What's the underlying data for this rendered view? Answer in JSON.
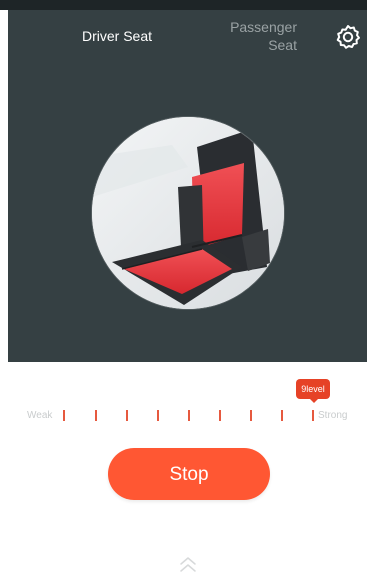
{
  "tabs": {
    "driver_label": "Driver Seat",
    "passenger_label": "Passenger\nSeat",
    "active": "driver"
  },
  "icons": {
    "settings": "gear-icon",
    "link": "link-icon",
    "expand": "chevron-up-icon"
  },
  "seat_image": "seat-photo",
  "intensity": {
    "weak_label": "Weak",
    "strong_label": "Strong",
    "level_label": "9level",
    "level": 9,
    "max_level": 9
  },
  "stop_label": "Stop",
  "colors": {
    "header_bg": "#354043",
    "accent": "#ff5733",
    "tick": "#e6593f",
    "badge": "#e64226",
    "link_icon": "#3fbf6d"
  }
}
